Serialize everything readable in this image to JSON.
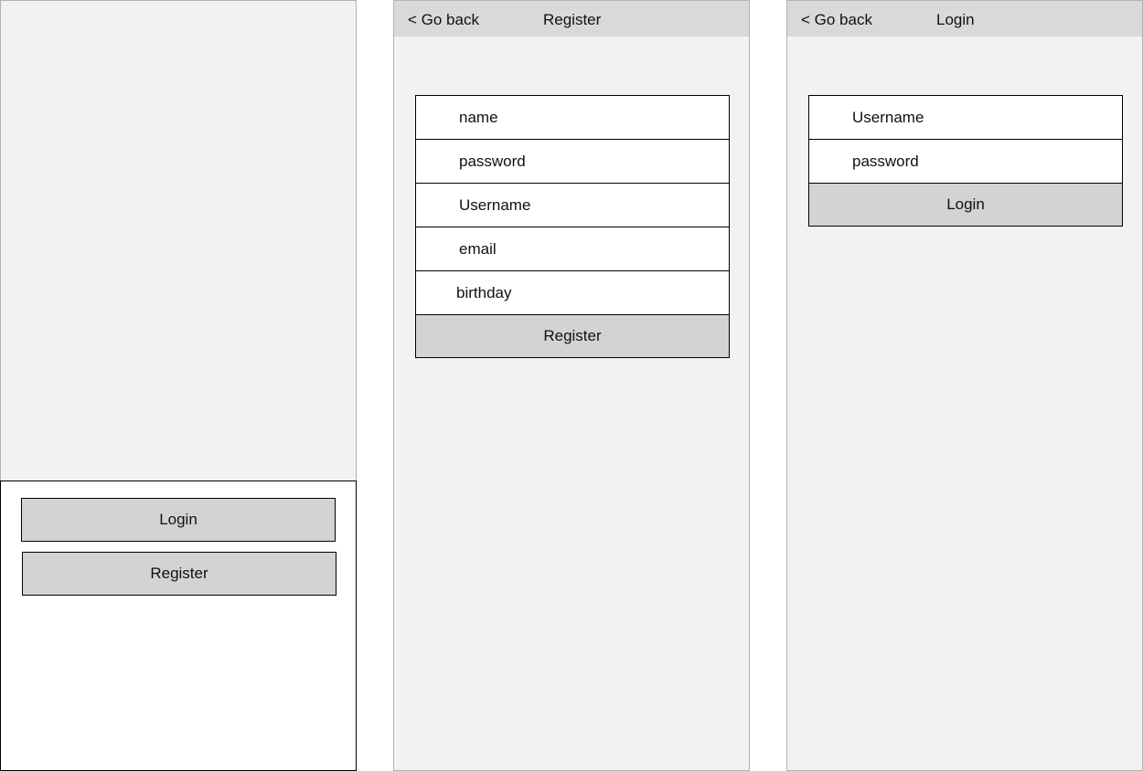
{
  "home": {
    "login_button": "Login",
    "register_button": "Register"
  },
  "register": {
    "go_back": "< Go back",
    "title": "Register",
    "fields": [
      "name",
      "password",
      "Username",
      "email",
      "birthday"
    ],
    "submit_button": "Register"
  },
  "login": {
    "go_back": "< Go back",
    "title": "Login",
    "fields": [
      "Username",
      "password"
    ],
    "submit_button": "Login"
  }
}
